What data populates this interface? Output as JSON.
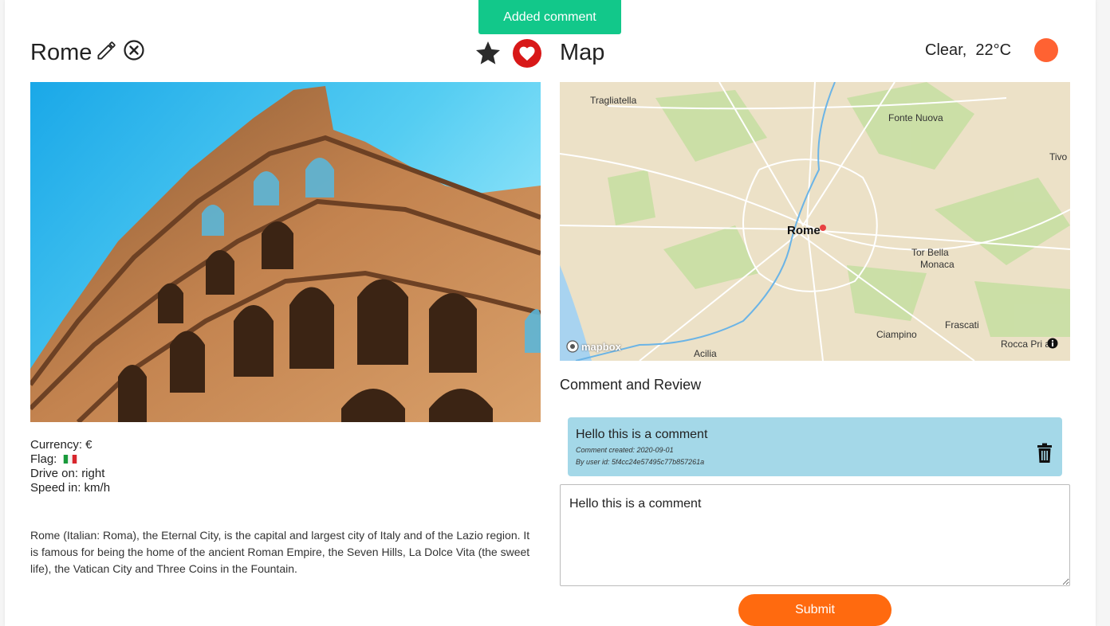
{
  "toast": {
    "message": "Added comment"
  },
  "city": {
    "name": "Rome",
    "currency": "Currency: €",
    "flag_label": "Flag:",
    "drive_on": "Drive on: right",
    "speed_in": "Speed in: km/h",
    "description": "Rome (Italian: Roma), the Eternal City, is the capital and largest city of Italy and of the Lazio region. It is famous for being the home of the ancient Roman Empire, the Seven Hills, La Dolce Vita (the sweet life), the Vatican City and Three Coins in the Fountain."
  },
  "actions": {
    "edit_icon": "pencil-icon",
    "delete_icon": "close-circle-icon",
    "rate_icon": "star-icon",
    "favorite_icon": "heart-icon",
    "favorite_color": "#d81818"
  },
  "map": {
    "title": "Map",
    "labels": {
      "trigliatella": "Tragliatella",
      "fonte_nuova": "Fonte Nuova",
      "tivoli": "Tivo",
      "rome": "Rome",
      "tor_bella_1": "Tor Bella",
      "tor_bella_2": "Monaca",
      "frascati": "Frascati",
      "ciampino": "Ciampino",
      "acilia": "Acilia",
      "rocca": "Rocca Pri a",
      "mapbox": "mapbox"
    }
  },
  "weather": {
    "text": "Clear,  22°C",
    "indicator_color": "#ff6232"
  },
  "comments": {
    "section_title": "Comment and Review",
    "items": [
      {
        "text": "Hello this is a comment",
        "created": "Comment created: 2020-09-01",
        "user": "By user id: 5f4cc24e57495c77b857261a"
      }
    ],
    "input_value": "Hello this is a comment",
    "submit_label": "Submit"
  }
}
